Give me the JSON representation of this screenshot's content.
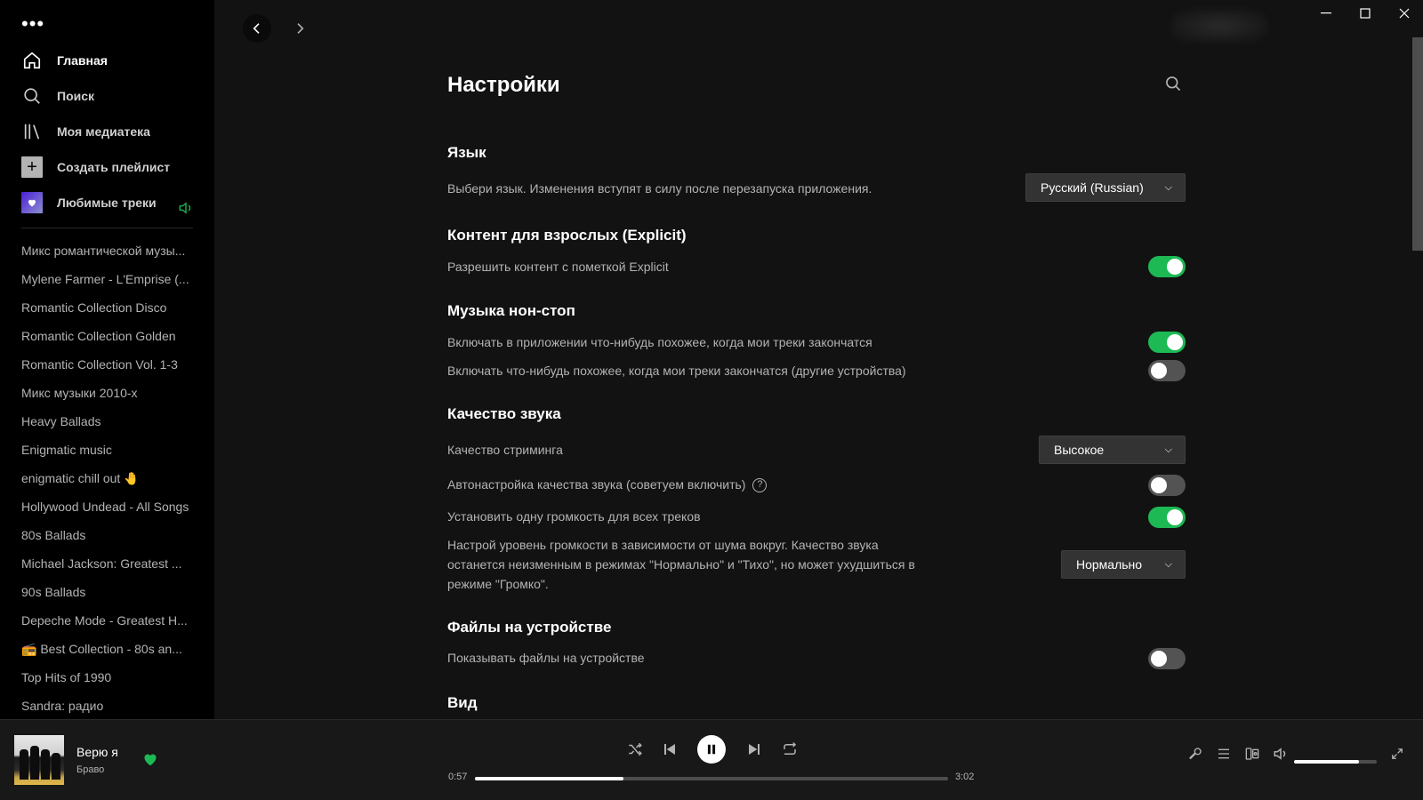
{
  "sidebar": {
    "menu_icon": "more-dots-icon",
    "nav": [
      {
        "label": "Главная",
        "icon": "home-icon"
      },
      {
        "label": "Поиск",
        "icon": "search-icon"
      },
      {
        "label": "Моя медиатека",
        "icon": "library-icon"
      }
    ],
    "create_playlist": "Создать плейлист",
    "liked_tracks": "Любимые треки",
    "playlists": [
      "Микс романтической музы...",
      "Mylene Farmer - L'Emprise (...",
      "Romantic Collection Disco",
      "Romantic Collection Golden",
      "Romantic Collection Vol. 1-3",
      "Микс музыки 2010-х",
      "Heavy Ballads",
      "Enigmatic music",
      "enigmatic chill out 🤚",
      "Hollywood Undead - All Songs",
      "80s Ballads",
      "Michael Jackson: Greatest ...",
      "90s Ballads",
      "Depeche Mode - Greatest H...",
      "📻 Best Collection - 80s an...",
      "Top Hits of 1990",
      "Sandra: радио"
    ]
  },
  "settings": {
    "title": "Настройки",
    "language": {
      "title": "Язык",
      "desc": "Выбери язык. Изменения вступят в силу после перезапуска приложения.",
      "value": "Русский (Russian)"
    },
    "explicit": {
      "title": "Контент для взрослых (Explicit)",
      "row1": "Разрешить контент с пометкой Explicit",
      "row1_on": true
    },
    "autoplay": {
      "title": "Музыка нон-стоп",
      "row1": "Включать в приложении что-нибудь похожее, когда мои треки закончатся",
      "row1_on": true,
      "row2": "Включать что-нибудь похожее, когда мои треки закончатся (другие устройства)",
      "row2_on": false
    },
    "quality": {
      "title": "Качество звука",
      "streaming_label": "Качество стриминга",
      "streaming_value": "Высокое",
      "auto_label": "Автонастройка качества звука (советуем включить)",
      "auto_on": false,
      "normalize_label": "Установить одну громкость для всех треков",
      "normalize_on": true,
      "level_desc": "Настрой уровень громкости в зависимости от шума вокруг. Качество звука останется неизменным в режимах \"Нормально\" и \"Тихо\", но может ухудшиться в режиме \"Громко\".",
      "level_value": "Нормально"
    },
    "local_files": {
      "title": "Файлы на устройстве",
      "row1": "Показывать файлы на устройстве",
      "row1_on": false
    },
    "view": {
      "title": "Вид"
    }
  },
  "player": {
    "track_title": "Верю я",
    "track_artist": "Браво",
    "liked": true,
    "elapsed": "0:57",
    "duration": "3:02",
    "progress": 0.313,
    "volume": 0.78
  },
  "colors": {
    "accent": "#1db954",
    "bg_main": "#121212",
    "bg_sidebar": "#000000",
    "bg_player": "#181818"
  }
}
